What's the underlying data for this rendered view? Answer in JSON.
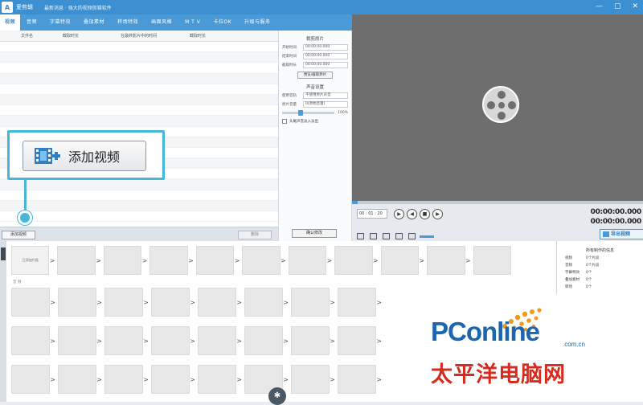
{
  "window": {
    "logo_glyph": "A",
    "app_name": "爱剪辑",
    "subtitle": "最新消息 · 强大的视频剪辑软件",
    "min": "—",
    "max": "▢",
    "close": "✕"
  },
  "tabs": [
    {
      "label": "视频",
      "active": true
    },
    {
      "label": "音频"
    },
    {
      "label": "字幕特效"
    },
    {
      "label": "叠加素材"
    },
    {
      "label": "转场特效"
    },
    {
      "label": "画面风格"
    },
    {
      "label": "M T V"
    },
    {
      "label": "卡拉OK"
    },
    {
      "label": "升级与服务"
    }
  ],
  "list": {
    "columns": [
      "文件名",
      "截取时长",
      "在最终影片中的时间",
      "截取时长"
    ],
    "add_small": "添加视频",
    "delete": "删除"
  },
  "callout": {
    "label": "添加视频"
  },
  "side": {
    "section1": "裁剪原片",
    "fields": [
      {
        "label": "开始时间",
        "value": "00:00:00.000"
      },
      {
        "label": "结束时间",
        "value": "00:00:00.000"
      },
      {
        "label": "截取时长",
        "value": "00:00:00.000"
      }
    ],
    "preview_button": "预览/截取原片",
    "section2": "声音设置",
    "audio_fields": [
      {
        "label": "使用音轨",
        "value": "不使用原片声音"
      },
      {
        "label": "原片音量",
        "value": "0(原始音量)"
      }
    ],
    "slider_value": "100%",
    "check_label": "头尾声音淡入淡出",
    "confirm": "确认修改"
  },
  "player": {
    "time_input": "00 : 01 : 20",
    "timecode_top": "00:00:00.000",
    "timecode_bottom": "00:00:00.000",
    "progress": 0.02,
    "export": "导出视频"
  },
  "timeline": {
    "track_label": "音 频",
    "first_cell_text": "已添加片段"
  },
  "info": {
    "title": "所有制作的信息",
    "rows": [
      {
        "k": "视频",
        "v": "0个片段"
      },
      {
        "k": "音频",
        "v": "0个片段"
      },
      {
        "k": "字幕特效",
        "v": "0个"
      },
      {
        "k": "叠加素材",
        "v": "0个"
      },
      {
        "k": "转场",
        "v": "0个"
      }
    ]
  },
  "watermark": {
    "brand": "PConline",
    "domain": ".com.cn",
    "cn_name": "太平洋电脑网"
  },
  "colors": {
    "accent": "#3c8fd0",
    "callout": "#47b6d9",
    "watermark_blue": "#1b66b0",
    "watermark_red": "#d62b1f"
  }
}
